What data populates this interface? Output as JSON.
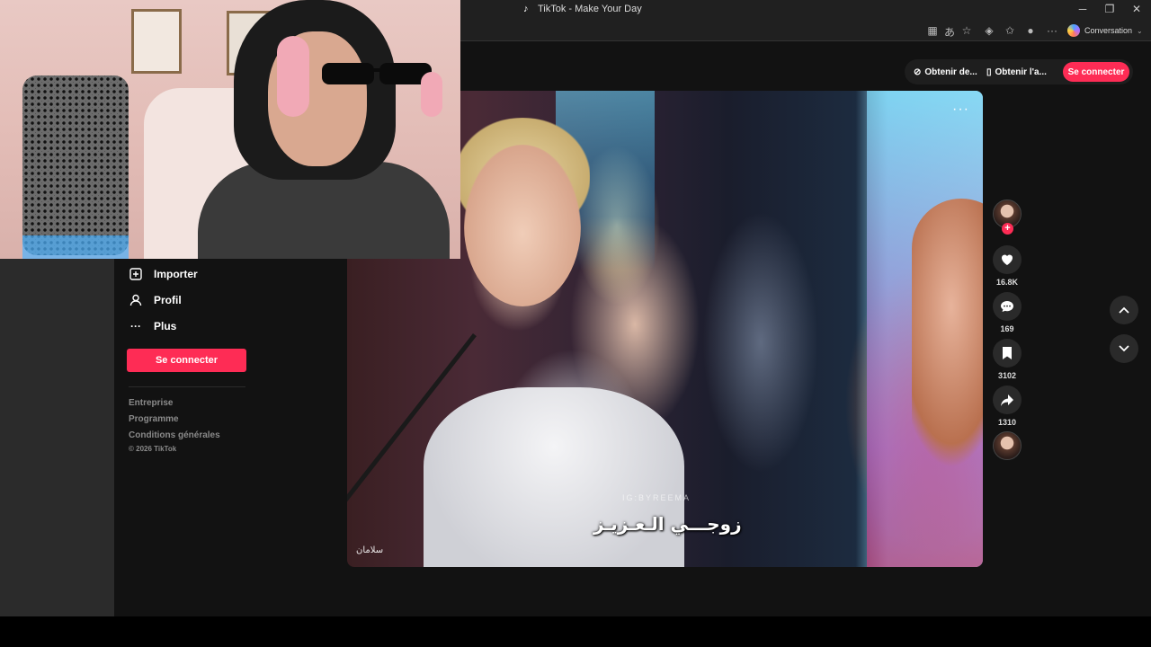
{
  "window": {
    "title": "TikTok - Make Your Day",
    "controls": {
      "minimize": "─",
      "restore": "❐",
      "close": "✕"
    }
  },
  "toolbar": {
    "more": "···",
    "conversation_label": "Conversation"
  },
  "sidebar": {
    "items": [
      {
        "label": "Importer",
        "icon": "upload-icon"
      },
      {
        "label": "Profil",
        "icon": "person-icon"
      },
      {
        "label": "Plus",
        "icon": "more-icon"
      }
    ],
    "login_label": "Se connecter",
    "footer_links": [
      "Entreprise",
      "Programme",
      "Conditions générales"
    ],
    "copyright": "© 2026 TikTok"
  },
  "header": {
    "get_coins_label": "Obtenir de...",
    "get_app_label": "Obtenir l'a...",
    "login_label": "Se connecter"
  },
  "video": {
    "caption": "زوجـــي الـعـزيـز",
    "watermark": "IG:BYREEMA",
    "channel_logo": "سلامان",
    "more": "···"
  },
  "actions": {
    "likes": "16.8K",
    "comments": "169",
    "saves": "3102",
    "shares": "1310"
  },
  "colors": {
    "accent": "#fe2c55",
    "page_bg": "#121212"
  }
}
